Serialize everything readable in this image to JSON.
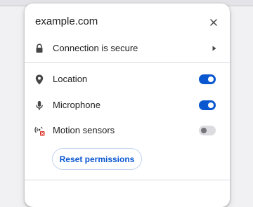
{
  "popup": {
    "site": "example.com",
    "close_icon": "close-icon",
    "connection": {
      "label": "Connection is secure",
      "icon": "lock-icon",
      "chevron_icon": "chevron-right-icon"
    },
    "permissions": [
      {
        "label": "Location",
        "icon": "location-pin-icon",
        "enabled": true
      },
      {
        "label": "Microphone",
        "icon": "microphone-icon",
        "enabled": true
      },
      {
        "label": "Motion sensors",
        "icon": "motion-sensors-blocked-icon",
        "enabled": false
      }
    ],
    "reset_label": "Reset permissions"
  },
  "colors": {
    "accent": "#0b57d0",
    "blocked": "#d93025",
    "toggle_off_track": "#dcdce0",
    "icon_gray": "#474747"
  }
}
